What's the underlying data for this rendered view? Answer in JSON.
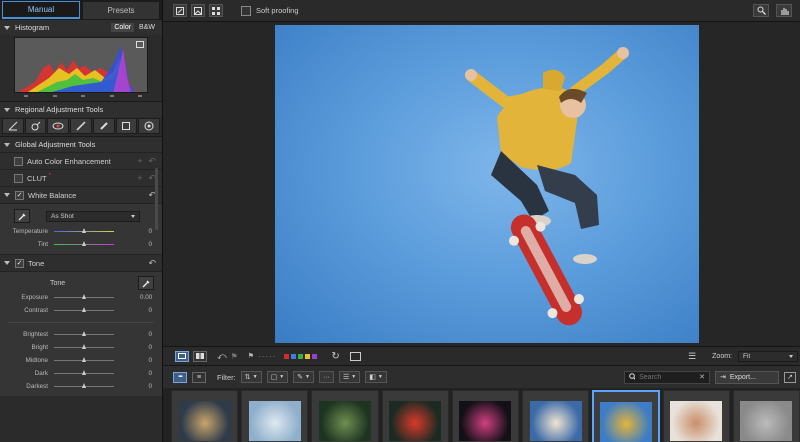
{
  "tabs": [
    {
      "label": "Manual",
      "active": true
    },
    {
      "label": "Presets",
      "active": false
    }
  ],
  "histogram": {
    "title": "Histogram",
    "modes": [
      "Color",
      "B&W"
    ],
    "active_mode": "Color"
  },
  "regional": {
    "title": "Regional Adjustment Tools"
  },
  "global": {
    "title": "Global Adjustment Tools"
  },
  "auto_color": {
    "label": "Auto Color Enhancement"
  },
  "clut": {
    "label": "CLUT",
    "mark": "*"
  },
  "white_balance": {
    "label": "White Balance",
    "checked": "✓",
    "preset": "As Shot",
    "sliders": [
      {
        "label": "Temperature",
        "value": "0",
        "level": 0.5
      },
      {
        "label": "Tint",
        "value": "0",
        "level": 0.5
      }
    ]
  },
  "tone": {
    "label": "Tone",
    "checked": "✓",
    "sub_title": "Tone",
    "sliders_a": [
      {
        "label": "Exposure",
        "value": "0.00",
        "level": 0.5
      },
      {
        "label": "Contrast",
        "value": "0",
        "level": 0.5
      }
    ],
    "sliders_b": [
      {
        "label": "Brightest",
        "value": "0",
        "level": 0.5
      },
      {
        "label": "Bright",
        "value": "0",
        "level": 0.5
      },
      {
        "label": "Midtone",
        "value": "0",
        "level": 0.5
      },
      {
        "label": "Dark",
        "value": "0",
        "level": 0.5
      },
      {
        "label": "Darkest",
        "value": "0",
        "level": 0.5
      }
    ]
  },
  "topbar": {
    "soft_proofing": "Soft proofing"
  },
  "viewer": {
    "zoom_label": "Zoom:",
    "zoom_value": "Fit"
  },
  "filterbar": {
    "filter_label": "Filter:",
    "search_placeholder": "Search",
    "export_label": "Export..."
  },
  "colors": {
    "accent": "#4a90d9",
    "sky": "#5c9ddc",
    "labels": [
      "#d42a2a",
      "#3b7de0",
      "#3fae3f",
      "#e6c52a",
      "#9a3fd6"
    ]
  },
  "filmstrip": {
    "thumbs": [
      {
        "name": "concert-stage",
        "c1": "#2e3b4a",
        "c2": "#c9a56b"
      },
      {
        "name": "lighthouse-sky",
        "c1": "#8fb0cc",
        "c2": "#dfe8f0"
      },
      {
        "name": "forest-trees",
        "c1": "#1d3420",
        "c2": "#6f8f52"
      },
      {
        "name": "red-flower",
        "c1": "#1b2a22",
        "c2": "#d93a2a"
      },
      {
        "name": "neon-city",
        "c1": "#141018",
        "c2": "#d04080"
      },
      {
        "name": "rocket-launch",
        "c1": "#3b6aa8",
        "c2": "#f0e4d0"
      },
      {
        "name": "skateboarder",
        "c1": "#3c7dc6",
        "c2": "#e2b43a",
        "selected": true
      },
      {
        "name": "portrait-woman",
        "c1": "#e8e2da",
        "c2": "#c98e6a"
      },
      {
        "name": "partial-thumb",
        "c1": "#8a8a8a",
        "c2": "#bbbbbb"
      }
    ]
  }
}
